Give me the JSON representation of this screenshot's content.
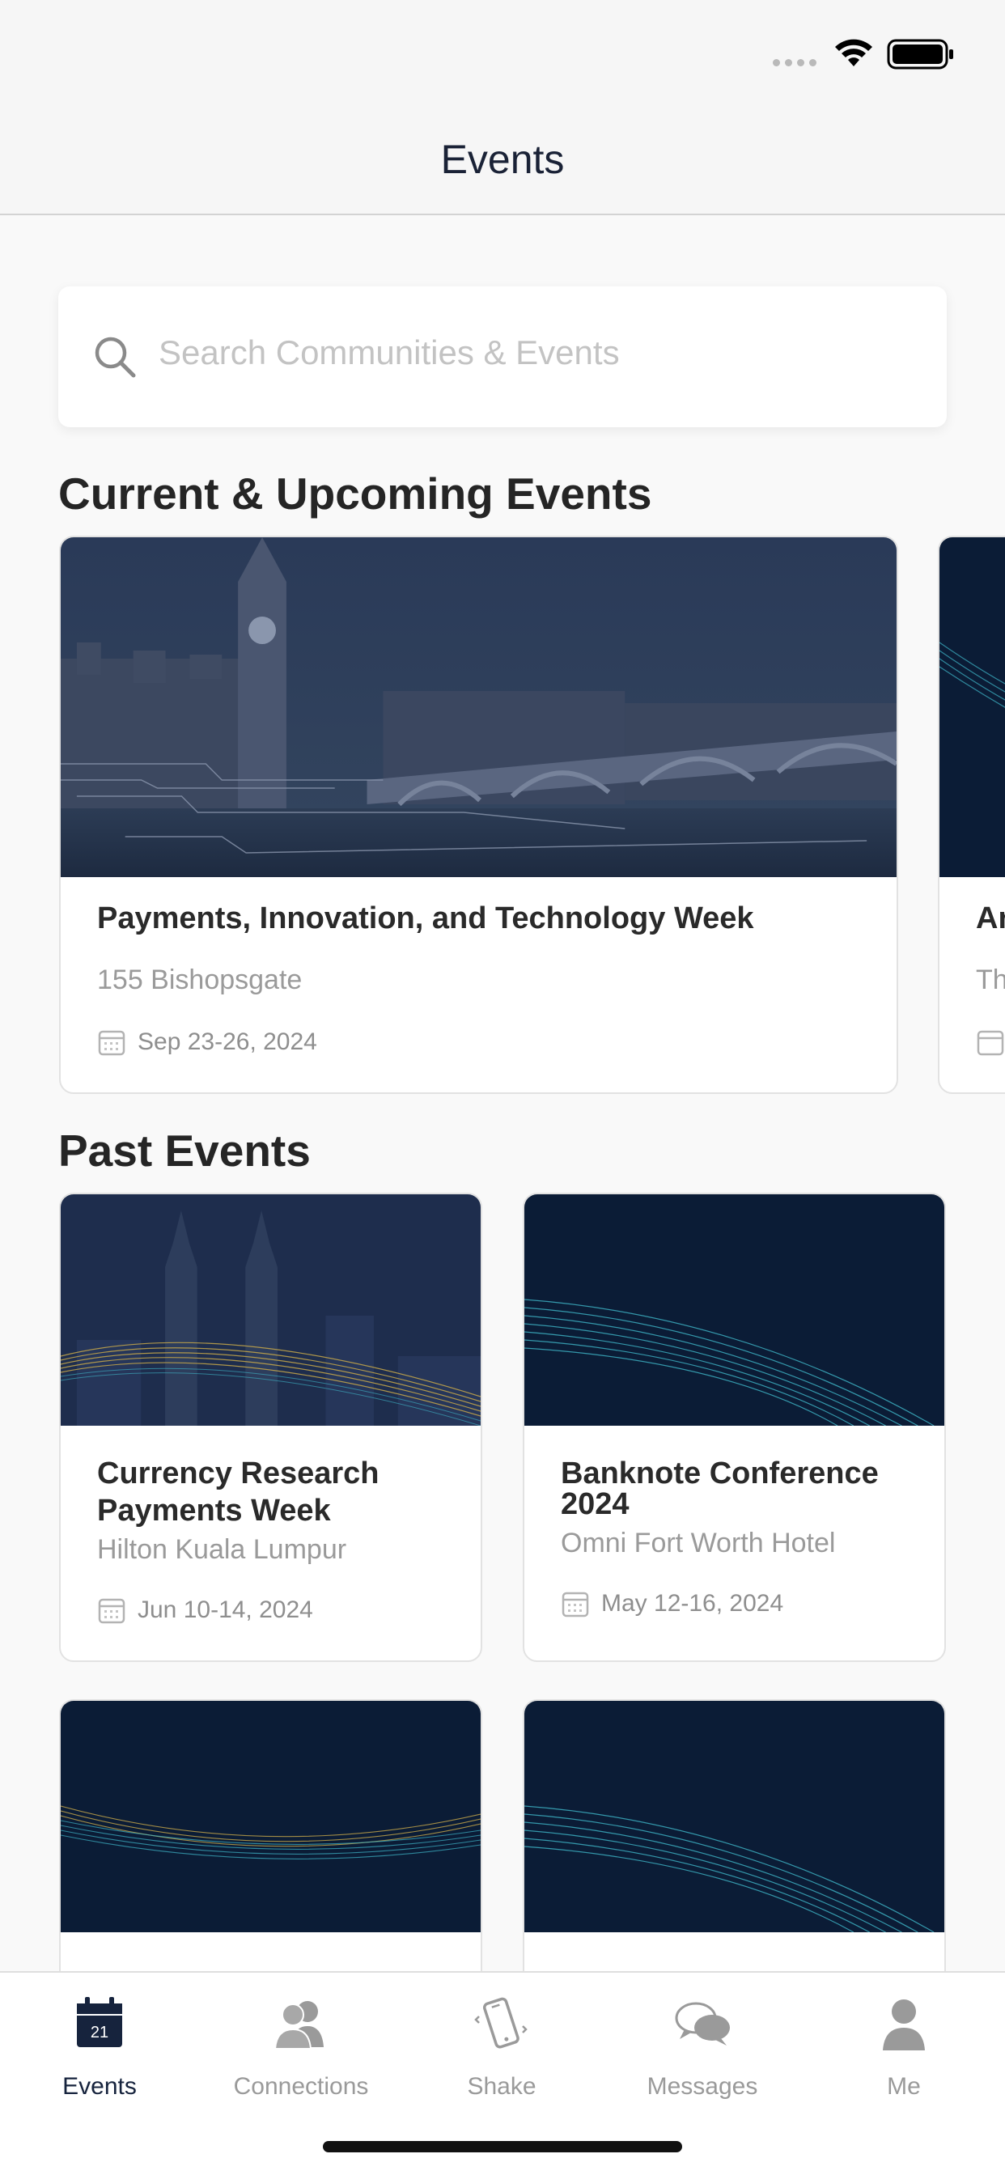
{
  "header": {
    "title": "Events"
  },
  "search": {
    "placeholder": "Search Communities & Events"
  },
  "sections": {
    "current": "Current & Upcoming Events",
    "past": "Past Events"
  },
  "current_events": [
    {
      "title": "Payments, Innovation, and Technology Week",
      "location": "155 Bishopsgate",
      "date": "Sep 23-26, 2024"
    },
    {
      "title": "Ar",
      "location": "Th",
      "date": ""
    }
  ],
  "past_events": [
    {
      "title_line1": "Currency Research",
      "title_line2": "Payments Week",
      "location": "Hilton Kuala Lumpur",
      "date": "Jun 10-14, 2024"
    },
    {
      "title_line1": "Banknote Conference",
      "title_line2": "2024",
      "location": "Omni Fort Worth Hotel",
      "date": "May 12-16, 2024"
    }
  ],
  "tabs": [
    {
      "label": "Events",
      "icon": "calendar-icon",
      "calendar_day": "21",
      "active": true
    },
    {
      "label": "Connections",
      "icon": "people-icon",
      "active": false
    },
    {
      "label": "Shake",
      "icon": "phone-shake-icon",
      "active": false
    },
    {
      "label": "Messages",
      "icon": "chat-bubbles-icon",
      "active": false
    },
    {
      "label": "Me",
      "icon": "person-icon",
      "active": false
    }
  ],
  "colors": {
    "navy": "#0b1c36",
    "accent_teal": "#3fb7c9",
    "accent_gold": "#c8a94a",
    "tab_active": "#16233d",
    "tab_inactive": "#9a9a9a"
  }
}
